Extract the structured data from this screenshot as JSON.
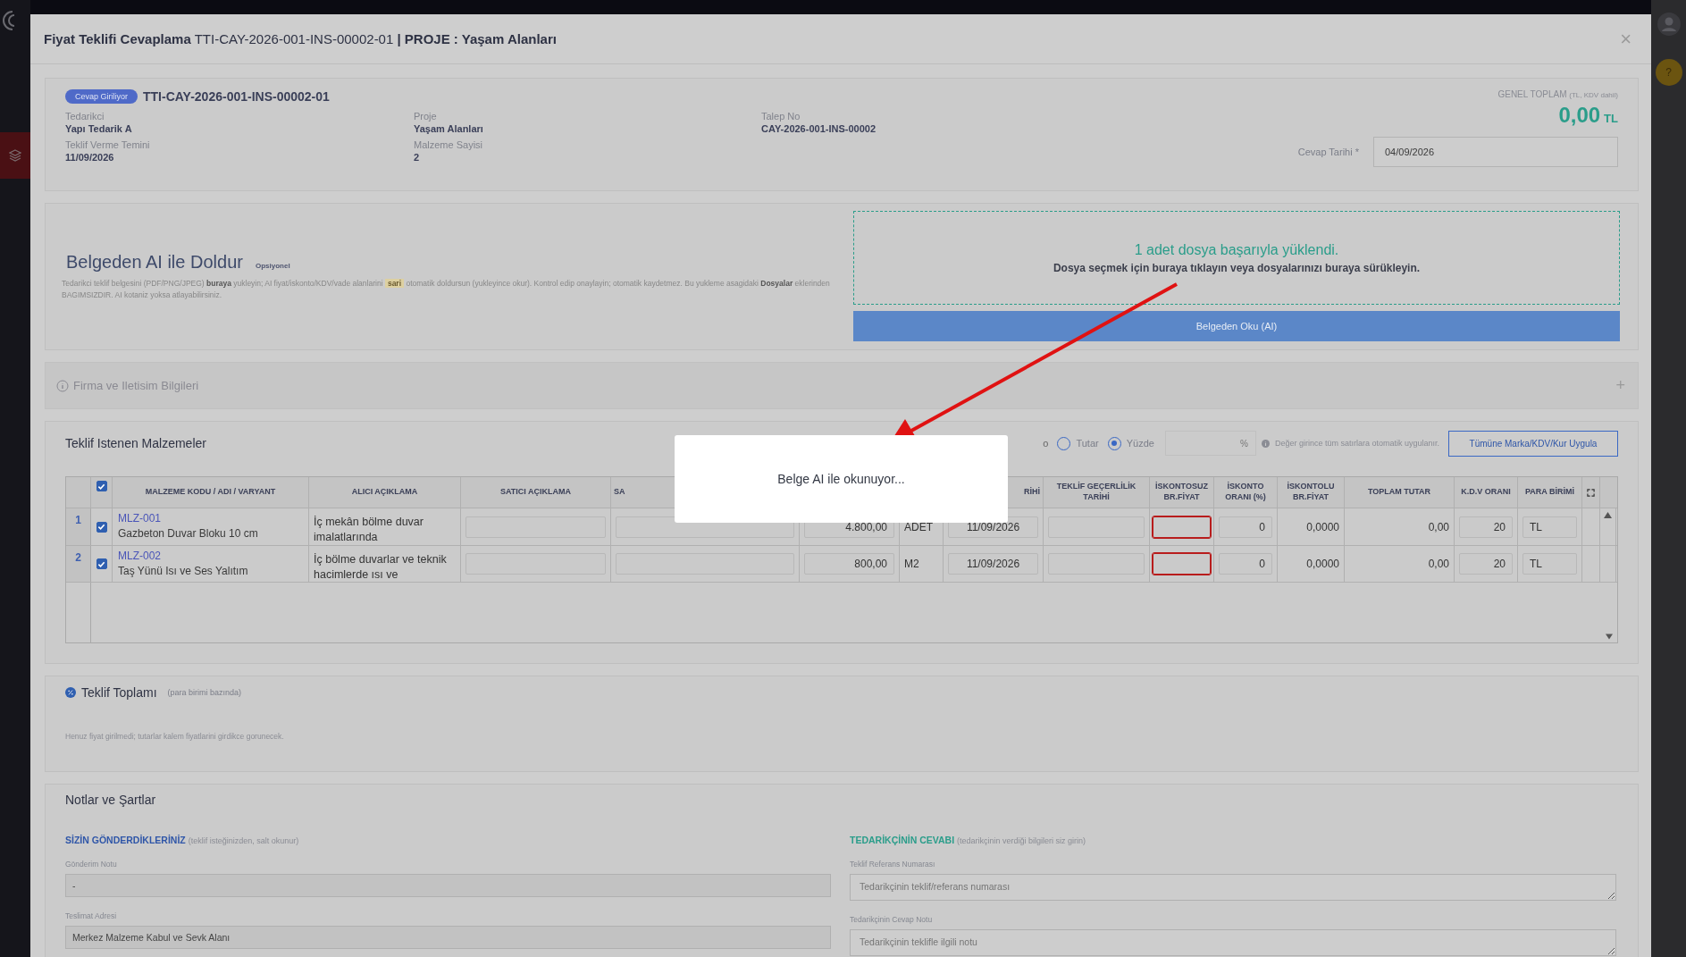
{
  "window": {
    "title": "**Fiyat Teklifi Cevaplama** TTI-CAY-2026-001-INS-00002-01 **| PROJE : Yaşam Alanları**",
    "close": "×"
  },
  "side": {
    "help": "?"
  },
  "summary": {
    "status_badge": "Cevap Giriliyor",
    "code": "TTI-CAY-2026-001-INS-00002-01",
    "fields": [
      {
        "label": "Tedarikci",
        "value": "Yapı Tedarik A"
      },
      {
        "label": "Proje",
        "value": "Yaşam Alanları"
      },
      {
        "label": "Talep No",
        "value": "CAY-2026-001-INS-00002"
      },
      {
        "label": "Teklif Verme Temini",
        "value": "11/09/2026"
      },
      {
        "label": "Malzeme Sayisi",
        "value": "2"
      }
    ],
    "total_label": "GENEL TOPLAM",
    "total_note": "(TL, KDV dahil)",
    "total_value": "0,00",
    "total_currency": "TL",
    "date_label": "Cevap Tarihi *",
    "date_value": "04/09/2026"
  },
  "ai_fill": {
    "title": "Belgeden AI ile Doldur",
    "tag": "Opsiyonel",
    "description_before": "Tedarikci teklif belgesini (PDF/PNG/JPEG) **buraya** yukleyin; AI fiyat/iskonto/KDV/vade alanlarini",
    "highlight": "sari",
    "description_after": "otomatik doldursun (yukleyince okur). Kontrol edip onaylayin; otomatik kaydetmez. Bu yukleme asagidaki **Dosyalar** eklerinden BAGIMSIZDIR. AI kotaniz yoksa atlayabilirsiniz.",
    "upload_success": "1 adet dosya başarıyla yüklendi.",
    "upload_hint": "Dosya seçmek için buraya tıklayın veya dosyalarınızı buraya sürükleyin.",
    "button": "Belgeden Oku (AI)"
  },
  "contact_section": {
    "title": "Firma ve Iletisim Bilgileri",
    "expanded": false,
    "toggle": "+"
  },
  "materials": {
    "title": "Teklif Istenen Malzemeler",
    "type_label": "o",
    "options": [
      {
        "label": "Tutar",
        "selected": false
      },
      {
        "label": "Yüzde",
        "selected": true
      }
    ],
    "percent_suffix": "%",
    "note": "Değer girince tüm satırlara otomatik uygulanır.",
    "apply_button": "Tümüne Marka/KDV/Kur Uygula",
    "all_checked": true,
    "columns": [
      {
        "label": "MALZEME KODU / ADI / VARYANT"
      },
      {
        "label": "ALICI AÇIKLAMA"
      },
      {
        "label": "SATICI AÇIKLAMA"
      },
      {
        "label": "SA"
      },
      {},
      {},
      {
        "label": "RİHİ"
      },
      {
        "label": "TEKLİF GEÇERLİLİK TARİHİ"
      },
      {
        "label": "İSKONTOSUZ BR.FİYAT"
      },
      {
        "label": "İSKONTO ORANI (%)"
      },
      {
        "label": "İSKONTOLU BR.FİYAT"
      },
      {
        "label": "TOPLAM TUTAR"
      },
      {
        "label": "K.D.V ORANI"
      },
      {
        "label": "PARA BİRİMİ"
      }
    ],
    "rows": [
      {
        "number": "1",
        "checked": true,
        "code": "MLZ-001",
        "name": "Gazbeton Duvar Bloku 10 cm",
        "buyer_note": "İç mekân bölme duvar imalatlarında",
        "quantity": "4.800,00",
        "unit": "ADET",
        "delivery_date": "11/09/2026",
        "price_missing": true,
        "discount_rate": "0",
        "discounted_price": "0,0000",
        "total": "0,00",
        "vat": "20",
        "currency": "TL"
      },
      {
        "number": "2",
        "checked": true,
        "code": "MLZ-002",
        "name": "Taş Yünü Isı ve Ses Yalıtım",
        "buyer_note": "İç bölme duvarlar ve teknik hacimlerde ısı ve",
        "quantity": "800,00",
        "unit": "M2",
        "delivery_date": "11/09/2026",
        "price_missing": true,
        "discount_rate": "0",
        "discounted_price": "0,0000",
        "total": "0,00",
        "vat": "20",
        "currency": "TL"
      }
    ]
  },
  "totals": {
    "title": "Teklif Toplamı",
    "subtitle": "(para birimi bazında)",
    "empty_note": "Henuz fiyat girilmedi; tutarlar kalem fiyatlarini girdikce gorunecek."
  },
  "notes": {
    "title": "Notlar ve Şartlar",
    "sent": {
      "title": "SİZİN GÖNDERDİKLERİNİZ",
      "subtitle": "(teklif isteğinizden, salt okunur)",
      "fields": [
        {
          "label": "Gönderim Notu",
          "value": "-"
        },
        {
          "label": "Teslimat Adresi",
          "value": "Merkez Malzeme Kabul ve Sevk Alanı"
        }
      ]
    },
    "reply": {
      "title": "TEDARİKÇİNİN CEVABI",
      "subtitle": "(tedarikçinin verdiği bilgileri siz girin)",
      "fields": [
        {
          "label": "Teklif Referans Numarası",
          "placeholder": "Tedarikçinin teklif/referans numarası"
        },
        {
          "label": "Tedarikçinin Cevap Notu",
          "placeholder": "Tedarikçinin teklifle ilgili notu"
        }
      ]
    }
  },
  "loading": {
    "message": "Belge AI ile okunuyor..."
  }
}
